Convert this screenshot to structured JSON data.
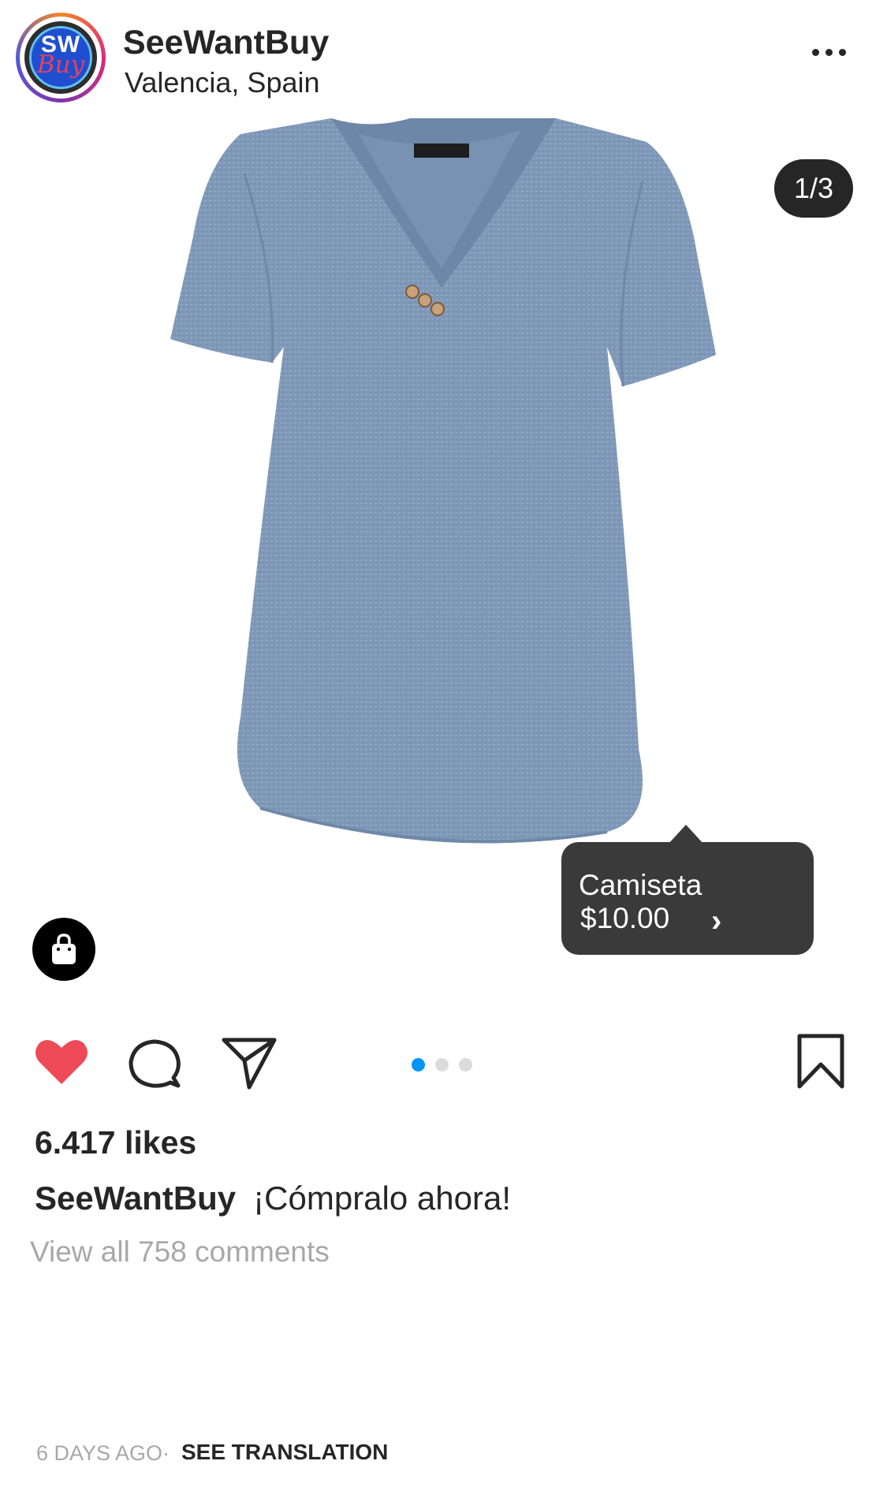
{
  "header": {
    "username": "SeeWantBuy",
    "location": "Valencia, Spain",
    "avatar_text_top": "SW",
    "avatar_text_bottom": "Buy"
  },
  "media": {
    "counter": "1/3",
    "product_color": "#7f98b8",
    "product_tag": {
      "name": "Camiseta",
      "price": "$10.00"
    }
  },
  "actions": {
    "like_color": "#ed4956",
    "active_dot_color": "#0095f6",
    "carousel_pages": 3,
    "carousel_active": 1
  },
  "post": {
    "likes": "6.417 likes",
    "caption_user": "SeeWantBuy",
    "caption_text": "¡Cómpralo ahora!",
    "comments_link": "View all 758 comments",
    "time": "6 DAYS AGO·",
    "translation": "SEE TRANSLATION"
  }
}
